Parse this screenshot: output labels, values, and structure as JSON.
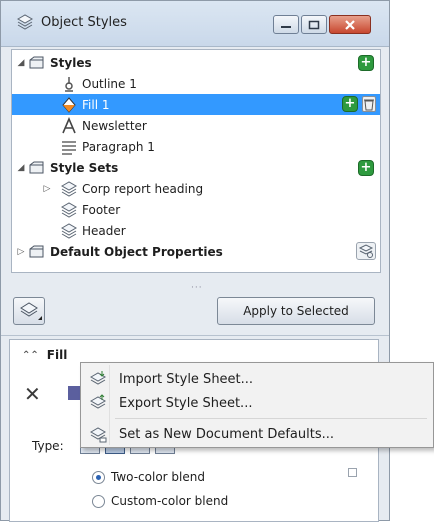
{
  "window": {
    "title": "Object Styles",
    "icon": "object-styles-icon",
    "controls": [
      "minimize",
      "maximize",
      "close"
    ]
  },
  "tree": {
    "styles_group": {
      "label": "Styles",
      "expanded": true
    },
    "styles": [
      {
        "label": "Outline 1",
        "icon": "outline-icon"
      },
      {
        "label": "Fill 1",
        "icon": "fill-icon",
        "selected": true
      },
      {
        "label": "Newsletter",
        "icon": "text-style-icon"
      },
      {
        "label": "Paragraph 1",
        "icon": "paragraph-icon"
      }
    ],
    "style_sets_group": {
      "label": "Style Sets",
      "expanded": true
    },
    "style_sets": [
      {
        "label": "Corp report heading",
        "icon": "style-set-icon",
        "expandable": true
      },
      {
        "label": "Footer",
        "icon": "style-set-icon"
      },
      {
        "label": "Header",
        "icon": "style-set-icon"
      }
    ],
    "default_group": {
      "label": "Default Object Properties",
      "expanded": false
    }
  },
  "toolbar": {
    "apply_label": "Apply to Selected"
  },
  "fill": {
    "header": "Fill",
    "type_label": "Type:",
    "fill_color": "#5b5f9e",
    "options": [
      {
        "label": "Two-color blend",
        "checked": true
      },
      {
        "label": "Custom-color blend",
        "checked": false
      }
    ]
  },
  "context_menu": {
    "items": [
      {
        "label": "Import Style Sheet...",
        "icon": "import-style-sheet-icon"
      },
      {
        "label": "Export Style Sheet...",
        "icon": "export-style-sheet-icon"
      },
      {
        "label": "Set as New Document Defaults...",
        "icon": "document-defaults-icon"
      }
    ]
  },
  "colors": {
    "selection": "#3399ff",
    "add_button": "#2e9a3e",
    "close_button": "#c7472f"
  }
}
